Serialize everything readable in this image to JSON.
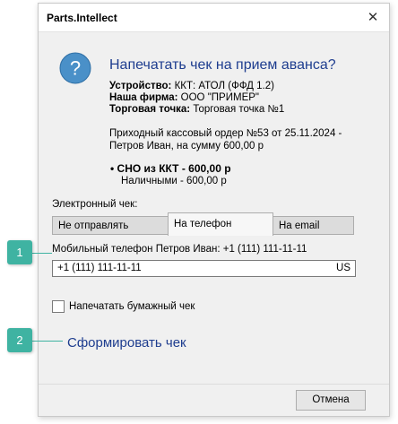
{
  "window": {
    "title": "Parts.Intellect",
    "close_glyph": "✕"
  },
  "dialog": {
    "icon": "question-icon",
    "icon_glyph": "?",
    "heading": "Напечатать чек на прием аванса?",
    "device_label": "Устройство:",
    "device_value": "ККТ: АТОЛ (ФФД 1.2)",
    "firm_label": "Наша фирма:",
    "firm_value": "ООО \"ПРИМЕР\"",
    "point_label": "Торговая точка:",
    "point_value": "Торговая точка №1",
    "receipt_text": "Приходный кассовый ордер №53 от 25.11.2024 - Петров Иван, на сумму 600,00 р",
    "sno_bullet": "•",
    "sno_line": "СНО из ККТ - 600,00 р",
    "sno_sub": "Наличными - 600,00 р"
  },
  "electronic": {
    "label": "Электронный чек:",
    "tabs": [
      {
        "label": "Не отправлять",
        "active": false
      },
      {
        "label": "На телефон",
        "active": true
      },
      {
        "label": "На email",
        "active": false
      }
    ],
    "phone_label": "Мобильный телефон Петров Иван: +1 (111) 111-11-11",
    "phone_value": "+1 (111) 111-11-11",
    "country_code": "US"
  },
  "paper_check": {
    "label": "Напечатать бумажный чек",
    "checked": false
  },
  "action": {
    "label": "Сформировать чек"
  },
  "footer": {
    "cancel_label": "Отмена"
  },
  "callouts": [
    {
      "number": "1"
    },
    {
      "number": "2"
    }
  ],
  "colors": {
    "accent": "#1e3d8f",
    "badge": "#3fb3a2",
    "icon": "#4a90c8"
  }
}
